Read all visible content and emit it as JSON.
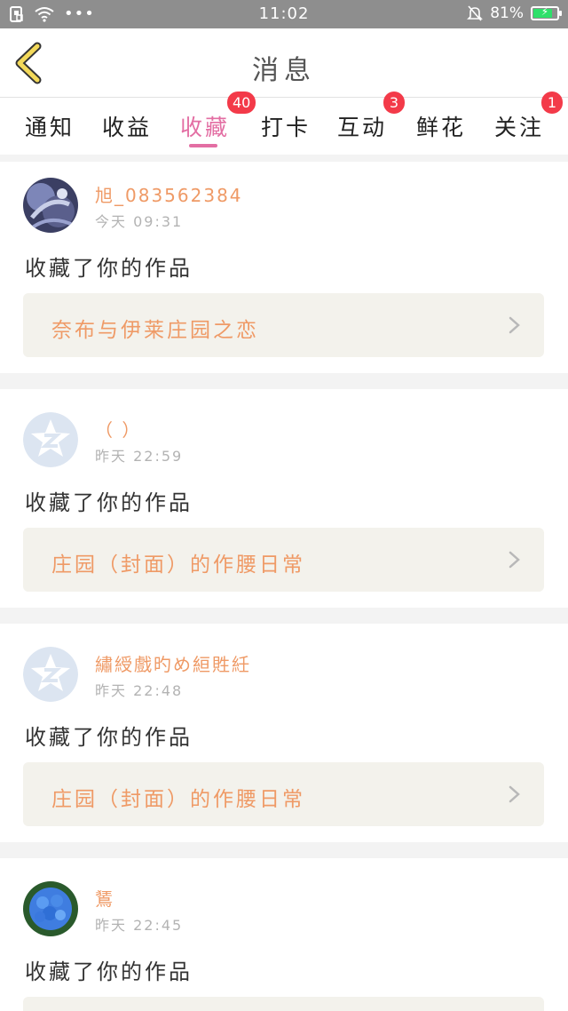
{
  "status_bar": {
    "time": "11:02",
    "battery_percent": "81%",
    "battery_level": 0.81
  },
  "header": {
    "title": "消息"
  },
  "tabs": [
    {
      "label": "通知",
      "badge": null,
      "active": false
    },
    {
      "label": "收益",
      "badge": null,
      "active": false
    },
    {
      "label": "收藏",
      "badge": "40",
      "active": true
    },
    {
      "label": "打卡",
      "badge": null,
      "active": false
    },
    {
      "label": "互动",
      "badge": "3",
      "active": false
    },
    {
      "label": "鲜花",
      "badge": null,
      "active": false
    },
    {
      "label": "关注",
      "badge": "1",
      "active": false
    }
  ],
  "messages": [
    {
      "user": "旭_083562384",
      "time": "今天 09:31",
      "action": "收藏了你的作品",
      "work_title": "奈布与伊莱庄园之恋",
      "avatar": "photo-avatar"
    },
    {
      "user": "（ ）",
      "time": "昨天 22:59",
      "action": "收藏了你的作品",
      "work_title": "庄园（封面）的作腰日常",
      "avatar": "qzone-default-avatar"
    },
    {
      "user": "繡綬戲旳め絙貹紝",
      "time": "昨天 22:48",
      "action": "收藏了你的作品",
      "work_title": "庄园（封面）的作腰日常",
      "avatar": "qzone-default-avatar"
    },
    {
      "user": "鵟",
      "time": "昨天 22:45",
      "action": "收藏了你的作品",
      "work_title": "",
      "avatar": "hydrangea-avatar"
    }
  ],
  "colors": {
    "accent_pink": "#e36ea3",
    "badge_red": "#f33a49",
    "username_orange": "#ef9a66",
    "status_bar_gray": "#8e8e8e",
    "back_arrow_yellow": "#f3d95a"
  }
}
